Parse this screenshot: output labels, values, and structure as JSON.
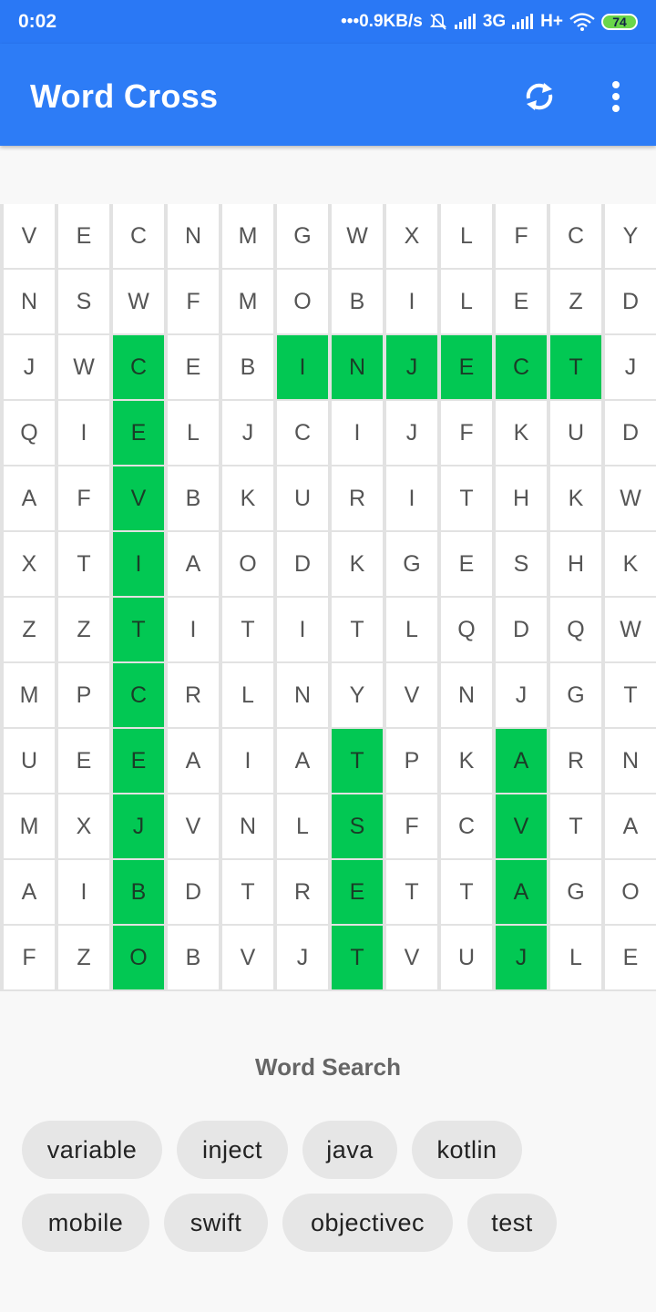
{
  "status_bar": {
    "time": "0:02",
    "network_speed": "•••0.9KB/s",
    "network_3g": "3G",
    "network_hplus": "H+",
    "battery": "74",
    "icons": [
      "mute-bell-icon",
      "signal-icon",
      "signal-icon",
      "wifi-icon",
      "battery-icon"
    ]
  },
  "app_bar": {
    "title": "Word Cross",
    "actions": [
      "refresh-icon",
      "more-vert-icon"
    ]
  },
  "grid": {
    "rows": [
      [
        "V",
        "E",
        "C",
        "N",
        "M",
        "G",
        "W",
        "X",
        "L",
        "F",
        "C",
        "Y"
      ],
      [
        "N",
        "S",
        "W",
        "F",
        "M",
        "O",
        "B",
        "I",
        "L",
        "E",
        "Z",
        "D"
      ],
      [
        "J",
        "W",
        "C",
        "E",
        "B",
        "I",
        "N",
        "J",
        "E",
        "C",
        "T",
        "J"
      ],
      [
        "Q",
        "I",
        "E",
        "L",
        "J",
        "C",
        "I",
        "J",
        "F",
        "K",
        "U",
        "D"
      ],
      [
        "A",
        "F",
        "V",
        "B",
        "K",
        "U",
        "R",
        "I",
        "T",
        "H",
        "K",
        "W"
      ],
      [
        "X",
        "T",
        "I",
        "A",
        "O",
        "D",
        "K",
        "G",
        "E",
        "S",
        "H",
        "K"
      ],
      [
        "Z",
        "Z",
        "T",
        "I",
        "T",
        "I",
        "T",
        "L",
        "Q",
        "D",
        "Q",
        "W"
      ],
      [
        "M",
        "P",
        "C",
        "R",
        "L",
        "N",
        "Y",
        "V",
        "N",
        "J",
        "G",
        "T"
      ],
      [
        "U",
        "E",
        "E",
        "A",
        "I",
        "A",
        "T",
        "P",
        "K",
        "A",
        "R",
        "N"
      ],
      [
        "M",
        "X",
        "J",
        "V",
        "N",
        "L",
        "S",
        "F",
        "C",
        "V",
        "T",
        "A"
      ],
      [
        "A",
        "I",
        "B",
        "D",
        "T",
        "R",
        "E",
        "T",
        "T",
        "A",
        "G",
        "O"
      ],
      [
        "F",
        "Z",
        "O",
        "B",
        "V",
        "J",
        "T",
        "V",
        "U",
        "J",
        "L",
        "E"
      ]
    ],
    "found_words": [
      {
        "word": "inject",
        "cells": [
          [
            2,
            5
          ],
          [
            2,
            6
          ],
          [
            2,
            7
          ],
          [
            2,
            8
          ],
          [
            2,
            9
          ],
          [
            2,
            10
          ]
        ]
      },
      {
        "word": "objectivec",
        "cells": [
          [
            2,
            2
          ],
          [
            3,
            2
          ],
          [
            4,
            2
          ],
          [
            5,
            2
          ],
          [
            6,
            2
          ],
          [
            7,
            2
          ],
          [
            8,
            2
          ],
          [
            9,
            2
          ],
          [
            10,
            2
          ],
          [
            11,
            2
          ]
        ]
      },
      {
        "word": "test",
        "cells": [
          [
            8,
            6
          ],
          [
            9,
            6
          ],
          [
            10,
            6
          ],
          [
            11,
            6
          ]
        ]
      },
      {
        "word": "java",
        "cells": [
          [
            8,
            9
          ],
          [
            9,
            9
          ],
          [
            10,
            9
          ],
          [
            11,
            9
          ]
        ]
      }
    ],
    "highlight_color": "#02c853"
  },
  "word_search": {
    "title": "Word Search",
    "words": [
      "variable",
      "inject",
      "java",
      "kotlin",
      "mobile",
      "swift",
      "objectivec",
      "test"
    ]
  },
  "colors": {
    "app_bar": "#2d7cf6",
    "status_bar": "#2a78f5",
    "highlight": "#02c853",
    "chip": "#e6e6e6"
  }
}
